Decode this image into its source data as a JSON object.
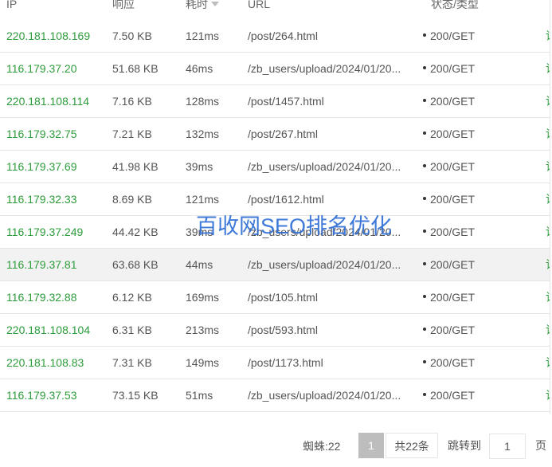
{
  "table": {
    "headers": {
      "ip": "IP",
      "response": "响应",
      "time": "耗时",
      "url": "URL",
      "status": "状态/类型"
    },
    "rows": [
      {
        "ip": "220.181.108.169",
        "size": "7.50 KB",
        "time": "121ms",
        "url": "/post/264.html",
        "status": "200/GET",
        "action": "详"
      },
      {
        "ip": "116.179.37.20",
        "size": "51.68 KB",
        "time": "46ms",
        "url": "/zb_users/upload/2024/01/20...",
        "status": "200/GET",
        "action": "详"
      },
      {
        "ip": "220.181.108.114",
        "size": "7.16 KB",
        "time": "128ms",
        "url": "/post/1457.html",
        "status": "200/GET",
        "action": "详"
      },
      {
        "ip": "116.179.32.75",
        "size": "7.21 KB",
        "time": "132ms",
        "url": "/post/267.html",
        "status": "200/GET",
        "action": "详"
      },
      {
        "ip": "116.179.37.69",
        "size": "41.98 KB",
        "time": "39ms",
        "url": "/zb_users/upload/2024/01/20...",
        "status": "200/GET",
        "action": "详"
      },
      {
        "ip": "116.179.32.33",
        "size": "8.69 KB",
        "time": "121ms",
        "url": "/post/1612.html",
        "status": "200/GET",
        "action": "详"
      },
      {
        "ip": "116.179.37.249",
        "size": "44.42 KB",
        "time": "39ms",
        "url": "/zb_users/upload/2024/01/20...",
        "status": "200/GET",
        "action": "详"
      },
      {
        "ip": "116.179.37.81",
        "size": "63.68 KB",
        "time": "44ms",
        "url": "/zb_users/upload/2024/01/20...",
        "status": "200/GET",
        "action": "详"
      },
      {
        "ip": "116.179.32.88",
        "size": "6.12 KB",
        "time": "169ms",
        "url": "/post/105.html",
        "status": "200/GET",
        "action": "详"
      },
      {
        "ip": "220.181.108.104",
        "size": "6.31 KB",
        "time": "213ms",
        "url": "/post/593.html",
        "status": "200/GET",
        "action": "详"
      },
      {
        "ip": "220.181.108.83",
        "size": "7.31 KB",
        "time": "149ms",
        "url": "/post/1173.html",
        "status": "200/GET",
        "action": "详"
      },
      {
        "ip": "116.179.37.53",
        "size": "73.15 KB",
        "time": "51ms",
        "url": "/zb_users/upload/2024/01/20...",
        "status": "200/GET",
        "action": "详"
      }
    ],
    "highlighted_row": 7
  },
  "watermark": "百收网SEO排名优化",
  "pager": {
    "count_label": "蜘蛛:22",
    "current_page": "1",
    "total_label": "共22条",
    "goto_label": "跳转到",
    "goto_value": "1",
    "page_suffix": "页"
  },
  "colors": {
    "ip_green": "#2c9c3a",
    "watermark_blue": "#2f6fd6",
    "current_page_bg": "#bdbdbd"
  }
}
